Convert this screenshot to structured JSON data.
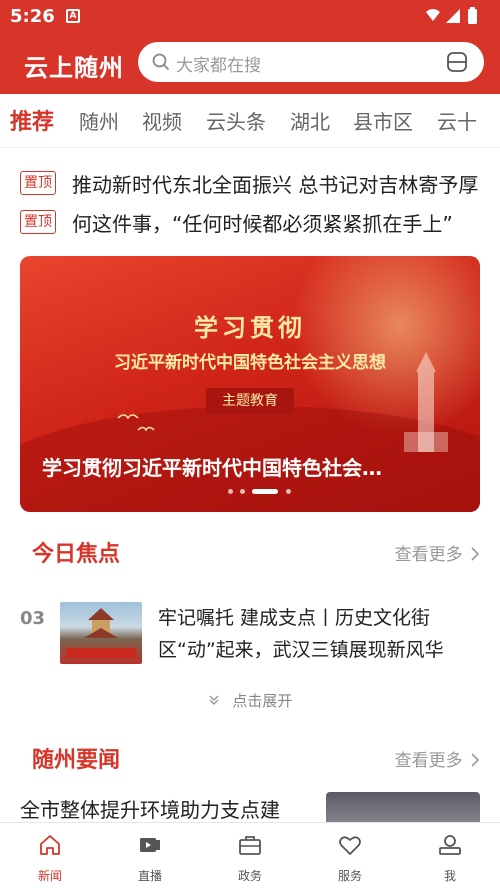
{
  "status_bar": {
    "time": "5:26",
    "badge": "A"
  },
  "header": {
    "logo": "云上随州",
    "search_placeholder": "大家都在搜"
  },
  "tabs": [
    {
      "label": "推荐"
    },
    {
      "label": "随州"
    },
    {
      "label": "视频"
    },
    {
      "label": "云头条"
    },
    {
      "label": "湖北"
    },
    {
      "label": "县市区"
    },
    {
      "label": "云十"
    }
  ],
  "pinned": [
    {
      "badge": "置顶",
      "text": "推动新时代东北全面振兴 总书记对吉林寄予厚"
    },
    {
      "badge": "置顶",
      "text": "何这件事，“任何时候都必须紧紧抓在手上”"
    }
  ],
  "banner": {
    "title1": "学习贯彻",
    "title2": "习近平新时代中国特色社会主义思想",
    "tag": "主题教育",
    "caption": "学习贯彻习近平新时代中国特色社会…",
    "dots_total": 4,
    "dots_active": 2
  },
  "focus": {
    "title": "今日焦点",
    "more": "查看更多",
    "item": {
      "number": "03",
      "title": "牢记嘱托 建成支点丨历史文化街区“动”起来，武汉三镇展现新风华"
    },
    "expand": "点击展开"
  },
  "local_news": {
    "title": "随州要闻",
    "more": "查看更多",
    "item_title": "全市整体提升环境助力支点建"
  },
  "bottom_nav": [
    {
      "label": "新闻",
      "icon": "home-icon"
    },
    {
      "label": "直播",
      "icon": "live-icon"
    },
    {
      "label": "政务",
      "icon": "briefcase-icon"
    },
    {
      "label": "服务",
      "icon": "heart-icon"
    },
    {
      "label": "我",
      "icon": "user-icon"
    }
  ],
  "colors": {
    "brand": "#d8352a",
    "text": "#222222",
    "muted": "#999999"
  }
}
